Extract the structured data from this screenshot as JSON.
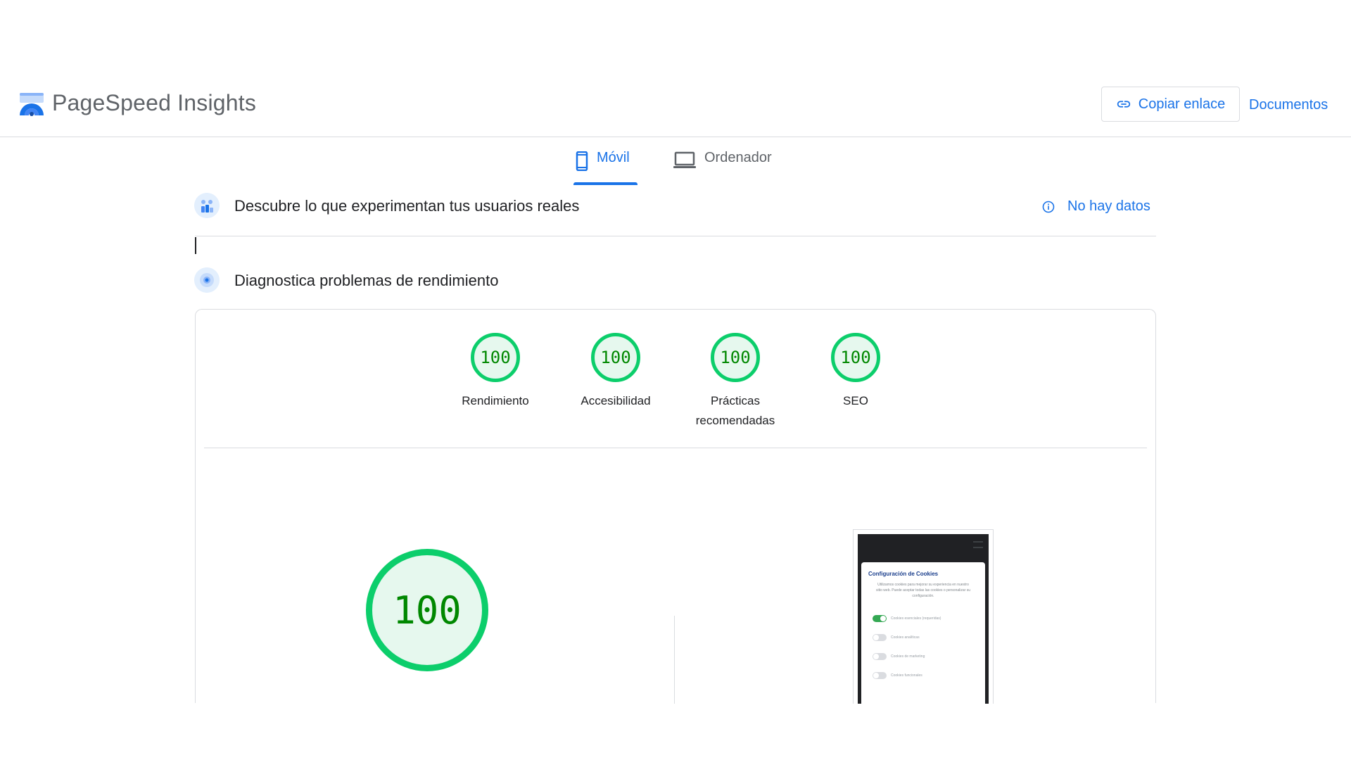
{
  "header": {
    "app_title": "PageSpeed Insights",
    "copy_link_label": "Copiar enlace",
    "docs_label": "Documentos"
  },
  "tabs": [
    {
      "label": "Móvil",
      "icon": "smartphone-icon",
      "active": true
    },
    {
      "label": "Ordenador",
      "icon": "laptop-icon",
      "active": false
    }
  ],
  "field_section": {
    "title": "Descubre lo que experimentan tus usuarios reales",
    "status": "No hay datos",
    "status_icon": "info-icon"
  },
  "lab_section": {
    "title": "Diagnostica problemas de rendimiento"
  },
  "scores": [
    {
      "value": "100",
      "label": "Rendimiento"
    },
    {
      "value": "100",
      "label": "Accesibilidad"
    },
    {
      "value": "100",
      "label": "Prácticas recomendadas"
    },
    {
      "value": "100",
      "label": "SEO"
    }
  ],
  "performance": {
    "score": "100"
  },
  "screenshot": {
    "modal_title": "Configuración de Cookies",
    "modal_text": "Utilizamos cookies para mejorar su experiencia en nuestro sitio web. Puede aceptar todas las cookies o personalizar su configuración.",
    "toggles": [
      {
        "label": "Cookies esenciales (requeridas)",
        "on": true
      },
      {
        "label": "Cookies analíticas",
        "on": false
      },
      {
        "label": "Cookies de marketing",
        "on": false
      },
      {
        "label": "Cookies funcionales",
        "on": false
      }
    ]
  },
  "colors": {
    "accent": "#1a73e8",
    "pass": "#0cce6b",
    "pass_text": "#008800",
    "pass_fill": "#e6f8ee"
  }
}
